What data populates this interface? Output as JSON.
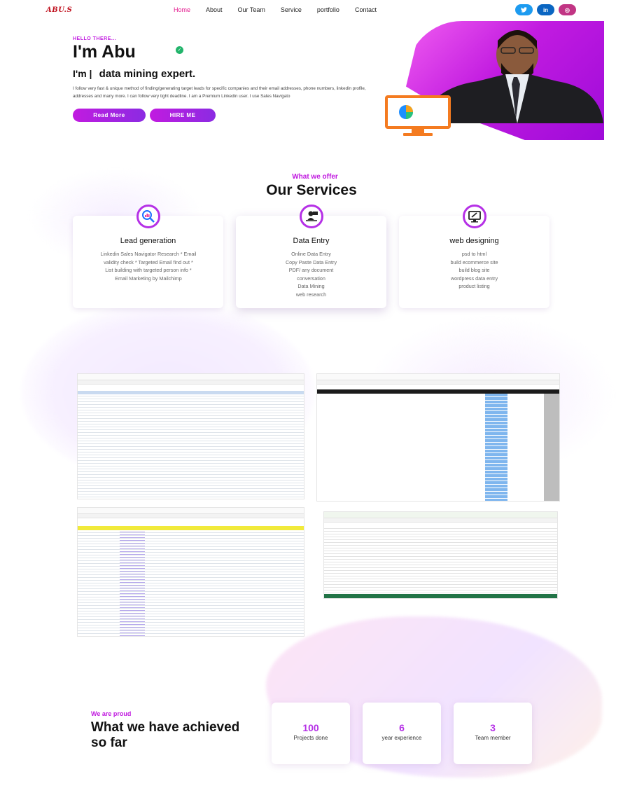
{
  "nav": {
    "logo": "ABU.S",
    "items": [
      {
        "label": "Home",
        "active": true
      },
      {
        "label": "About",
        "active": false
      },
      {
        "label": "Our Team",
        "active": false
      },
      {
        "label": "Service",
        "active": false
      },
      {
        "label": "portfolio",
        "active": false
      },
      {
        "label": "Contact",
        "active": false
      }
    ],
    "social": [
      {
        "icon": "twitter-icon",
        "glyph": "t",
        "color": "#1d9bf0"
      },
      {
        "icon": "linkedin-icon",
        "glyph": "in",
        "color": "#0a66c2"
      },
      {
        "icon": "instagram-icon",
        "glyph": "◎",
        "color": "#c13584"
      }
    ]
  },
  "hero": {
    "greeting": "HELLO THERE...",
    "name": "I'm Abu",
    "role_prefix": "I'm |",
    "role": "data mining expert.",
    "description": "I follow very fast & unique method of finding/generating target leads for specific companies and their email addresses, phone numbers, linkedin profile, addresses and many more. I can follow very tight deadline. I am a Premium Linkedin user. I use Sales Navigato",
    "buttons": {
      "read_more": "Read More",
      "hire_me": "HIRE ME"
    },
    "accent": "#c11be0"
  },
  "services": {
    "eyebrow": "What we offer",
    "title": "Our Services",
    "cards": [
      {
        "icon": "magnifier-chart-icon",
        "title": "Lead generation",
        "body": "Linkedin Sales Navigator Research * Email validity check * Targeted Email find out * List building with targeted person info * Email Marketing by Mailchimp"
      },
      {
        "icon": "data-entry-person-icon",
        "title": "Data Entry",
        "items": [
          "Online Data Entry",
          "Copy Paste Data Entry",
          "PDF/ any document",
          "conversation",
          "Data Mining",
          "web research"
        ]
      },
      {
        "icon": "monitor-design-icon",
        "title": "web designing",
        "items": [
          "psd to html",
          "build ecommerce site",
          "build blog site",
          "wordpress data entry",
          "product listing"
        ]
      }
    ]
  },
  "portfolio": {
    "shots": [
      {
        "name": "lead-list-spreadsheet"
      },
      {
        "name": "contacts-spreadsheet"
      },
      {
        "name": "company-list-spreadsheet"
      },
      {
        "name": "excel-data-sheet"
      }
    ]
  },
  "achievements": {
    "eyebrow": "We are proud",
    "title": "What we have achieved so far",
    "stats": [
      {
        "value": "100",
        "label": "Projects done"
      },
      {
        "value": "6",
        "label": "year experience"
      },
      {
        "value": "3",
        "label": "Team member"
      }
    ]
  }
}
